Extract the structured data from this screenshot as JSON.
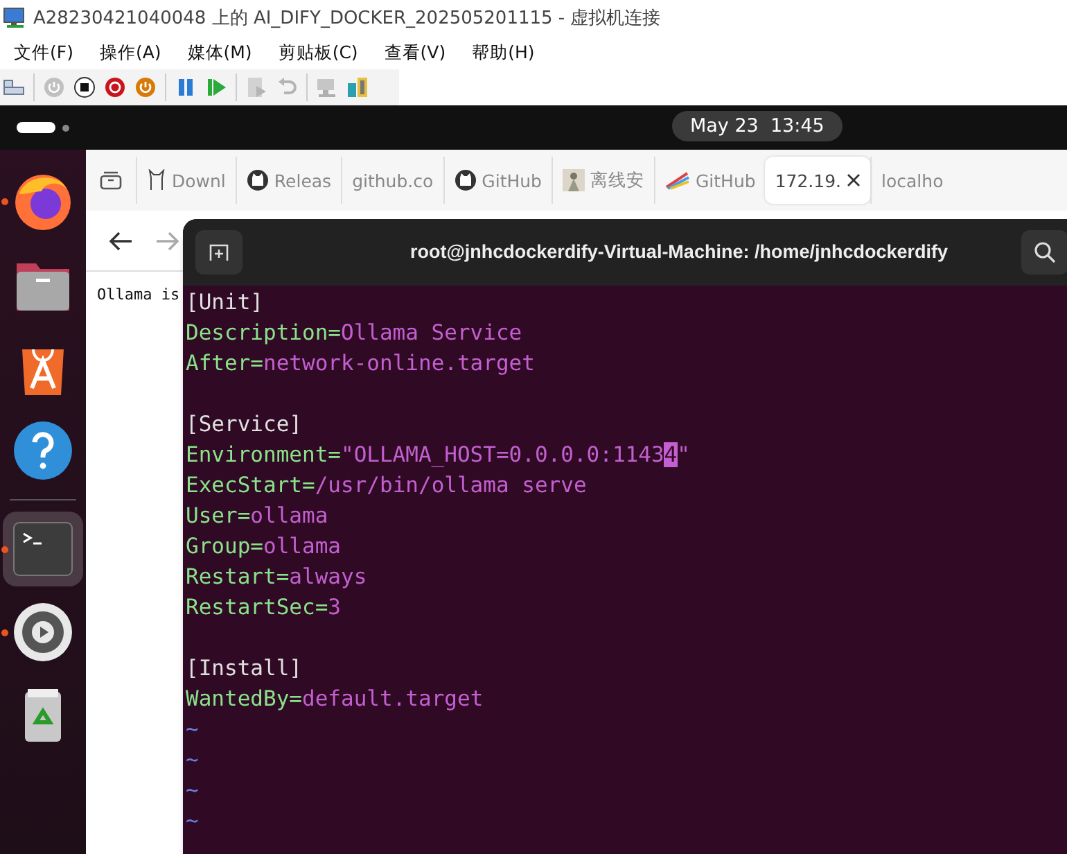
{
  "window": {
    "title": "A28230421040048 上的 AI_DIFY_DOCKER_202505201115 - 虚拟机连接"
  },
  "menu": [
    "文件(F)",
    "操作(A)",
    "媒体(M)",
    "剪贴板(C)",
    "查看(V)",
    "帮助(H)"
  ],
  "toolbar": {
    "groups": [
      [
        {
          "kind": "keyboard",
          "disabled": false
        }
      ],
      [
        {
          "kind": "start",
          "disabled": true
        },
        {
          "kind": "turn-off",
          "disabled": false
        },
        {
          "kind": "shut-down",
          "disabled": false
        },
        {
          "kind": "save",
          "disabled": false
        }
      ],
      [
        {
          "kind": "pause",
          "disabled": false
        },
        {
          "kind": "reset",
          "disabled": false
        }
      ],
      [
        {
          "kind": "checkpoint",
          "disabled": true
        },
        {
          "kind": "revert",
          "disabled": true
        }
      ],
      [
        {
          "kind": "enhanced",
          "disabled": true
        },
        {
          "kind": "share",
          "disabled": false
        }
      ]
    ]
  },
  "top_bar": {
    "clock": "May 23  13:45"
  },
  "dock": [
    {
      "kind": "firefox",
      "running": true,
      "selected": false
    },
    {
      "kind": "files",
      "running": false,
      "selected": false
    },
    {
      "kind": "app-center",
      "running": false,
      "selected": false
    },
    {
      "kind": "help",
      "running": false,
      "selected": false
    },
    {
      "kind": "terminal",
      "running": true,
      "selected": true
    },
    {
      "kind": "settings",
      "running": true,
      "selected": false
    },
    {
      "kind": "trash",
      "running": false,
      "selected": false
    }
  ],
  "browser": {
    "tabs": [
      {
        "label": "Downl",
        "kind": "llama",
        "selected": false
      },
      {
        "label": "Releas",
        "kind": "github",
        "selected": false
      },
      {
        "label": "github.co",
        "kind": "plain",
        "selected": false
      },
      {
        "label": "GitHub",
        "kind": "github",
        "selected": false
      },
      {
        "label": "离线安",
        "kind": "figure",
        "selected": false
      },
      {
        "label": "GitHub",
        "kind": "colorful",
        "selected": false
      },
      {
        "label": "172.19.",
        "kind": "plain",
        "selected": true
      },
      {
        "label": "localho",
        "kind": "plain",
        "selected": false
      }
    ],
    "content": "Ollama is"
  },
  "terminal": {
    "title": "root@jnhcdockerdify-Virtual-Machine: /home/jnhcdockerdify",
    "lines": [
      {
        "kind": "section",
        "text": "[Unit]"
      },
      {
        "kind": "entry",
        "key": "Description=",
        "value": "Ollama Service"
      },
      {
        "kind": "entry",
        "key": "After=",
        "value": "network-online.target"
      },
      {
        "kind": "empty"
      },
      {
        "kind": "section",
        "text": "[Service]"
      },
      {
        "kind": "entry",
        "key": "Environment=",
        "value": "\"OLLAMA_HOST=0.0.0.0:1143",
        "cursor": "4",
        "after": "\""
      },
      {
        "kind": "entry",
        "key": "ExecStart=",
        "value": "/usr/bin/ollama serve"
      },
      {
        "kind": "entry",
        "key": "User=",
        "value": "ollama"
      },
      {
        "kind": "entry",
        "key": "Group=",
        "value": "ollama"
      },
      {
        "kind": "entry",
        "key": "Restart=",
        "value": "always"
      },
      {
        "kind": "entry",
        "key": "RestartSec=",
        "value": "3"
      },
      {
        "kind": "empty"
      },
      {
        "kind": "section",
        "text": "[Install]"
      },
      {
        "kind": "entry",
        "key": "WantedBy=",
        "value": "default.target"
      },
      {
        "kind": "tilde",
        "text": "~"
      },
      {
        "kind": "tilde",
        "text": "~"
      },
      {
        "kind": "tilde",
        "text": "~"
      },
      {
        "kind": "tilde",
        "text": "~"
      }
    ]
  }
}
